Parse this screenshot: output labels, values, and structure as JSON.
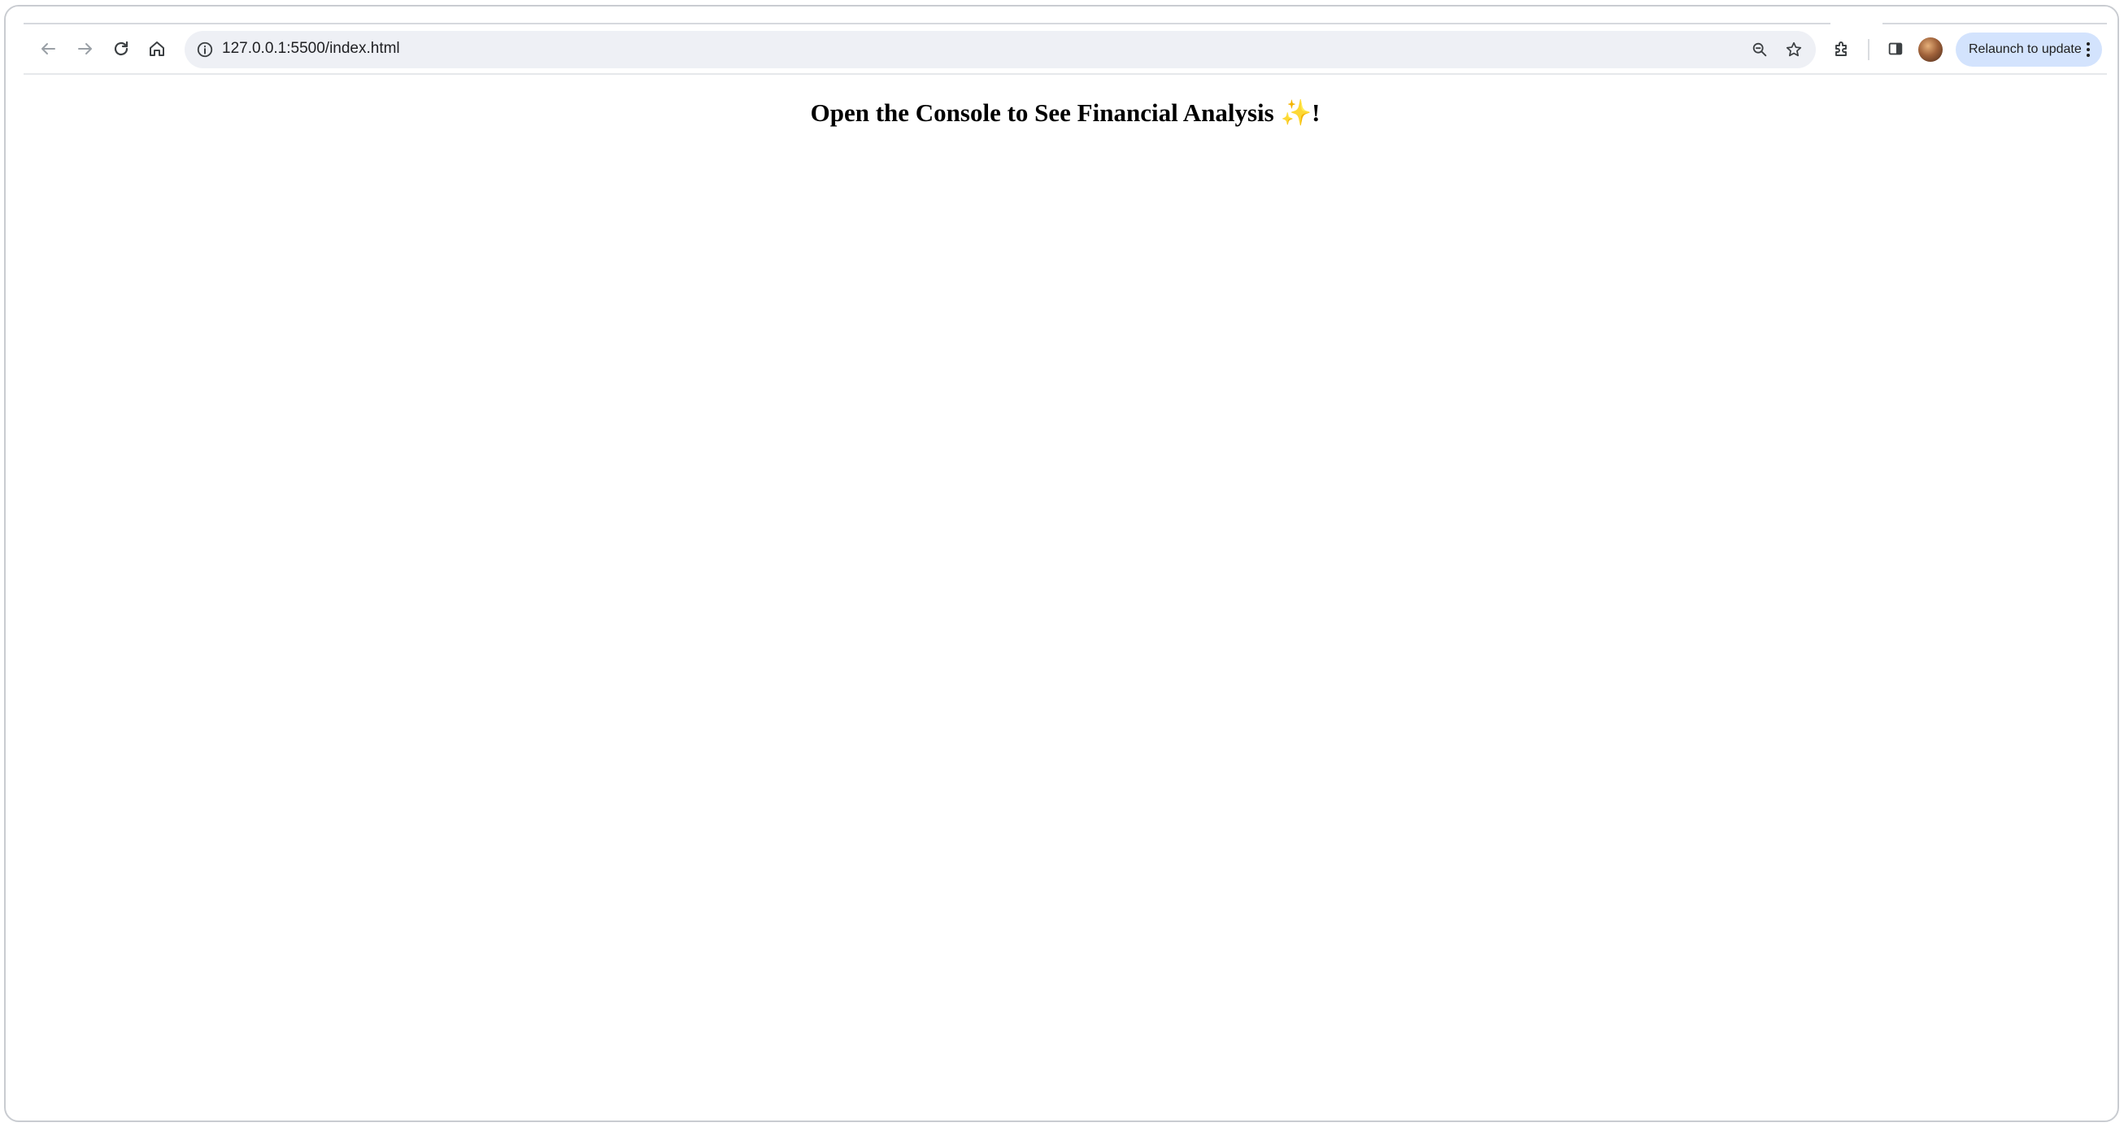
{
  "browser": {
    "url": "127.0.0.1:5500/index.html",
    "relaunch_label": "Relaunch to update",
    "icons": {
      "back": "back-arrow-icon",
      "forward": "forward-arrow-icon",
      "reload": "reload-icon",
      "home": "home-icon",
      "site_info": "info-icon",
      "zoom": "zoom-icon",
      "bookmark": "star-icon",
      "extensions": "puzzle-icon",
      "side_panel": "side-panel-icon",
      "menu": "kebab-menu-icon"
    },
    "colors": {
      "omnibox_bg": "#eef0f5",
      "relaunch_bg": "#d3e3fd"
    }
  },
  "page": {
    "heading_text": "Open the Console to See Financial Analysis",
    "heading_emoji": "✨",
    "heading_suffix": "!"
  }
}
